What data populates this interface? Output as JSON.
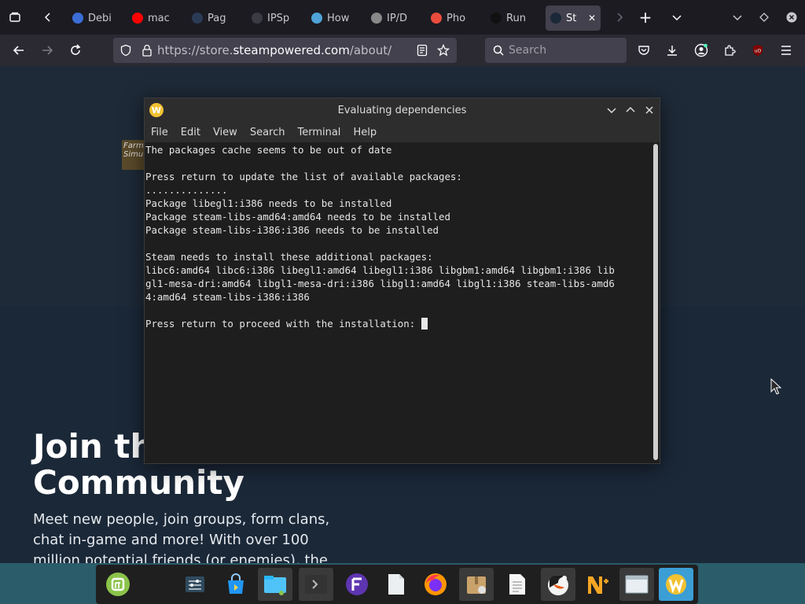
{
  "browser": {
    "tabs": [
      {
        "label": "Debi",
        "icon": "debian-icon",
        "color": "#3a6dd6"
      },
      {
        "label": "mac",
        "icon": "youtube-icon",
        "color": "#ff0000"
      },
      {
        "label": "Pag",
        "icon": "page-icon",
        "color": "#2b3a55"
      },
      {
        "label": "IPSp",
        "icon": "ipsp-icon",
        "color": "#3b3b44"
      },
      {
        "label": "How",
        "icon": "how-icon",
        "color": "#4fa3d8"
      },
      {
        "label": "IP/D",
        "icon": "ipd-icon",
        "color": "#888888"
      },
      {
        "label": "Pho",
        "icon": "photo-icon",
        "color": "#e94c3d"
      },
      {
        "label": "Run",
        "icon": "medium-icon",
        "color": "#111111"
      },
      {
        "label": "St",
        "icon": "steam-icon",
        "color": "#1b2838"
      }
    ],
    "url_prefix": "https://store.",
    "url_domain": "steampowered.com",
    "url_path": "/about/",
    "search_placeholder": "Search"
  },
  "page": {
    "join_title_line1": "Join th",
    "join_title_line2": "Community",
    "join_text_line1": "Meet new people, join groups, form clans,",
    "join_text_line2": "chat in-game and more! With over 100",
    "join_text_line3": "million potential friends (or enemies), the",
    "thumb_text": "Farm Simu"
  },
  "terminal": {
    "title": "Evaluating dependencies",
    "menu": [
      "File",
      "Edit",
      "View",
      "Search",
      "Terminal",
      "Help"
    ],
    "lines": [
      "The packages cache seems to be out of date",
      "",
      "Press return to update the list of available packages:",
      "..............",
      "Package libegl1:i386 needs to be installed",
      "Package steam-libs-amd64:amd64 needs to be installed",
      "Package steam-libs-i386:i386 needs to be installed",
      "",
      "Steam needs to install these additional packages:",
      "libc6:amd64 libc6:i386 libegl1:amd64 libegl1:i386 libgbm1:amd64 libgbm1:i386 lib",
      "gl1-mesa-dri:amd64 libgl1-mesa-dri:i386 libgl1:amd64 libgl1:i386 steam-libs-amd6",
      "4:amd64 steam-libs-i386:i386",
      "",
      "Press return to proceed with the installation: "
    ]
  },
  "taskbar": {
    "items": [
      "mint-menu-icon",
      "settings-icon",
      "software-store-icon",
      "file-manager-icon",
      "terminal-icon",
      "app-f-icon",
      "text-file-icon",
      "firefox-icon",
      "archive-manager-icon",
      "document-icon",
      "thunderbird-icon",
      "app-n-icon",
      "window-icon",
      "winetricks-icon"
    ]
  },
  "colors": {
    "steam_bg": "#1b2838",
    "taskbar_bg": "#2a5c6a",
    "active_dock": "#3b9ed4",
    "terminal_bg": "#1e1e1e"
  }
}
